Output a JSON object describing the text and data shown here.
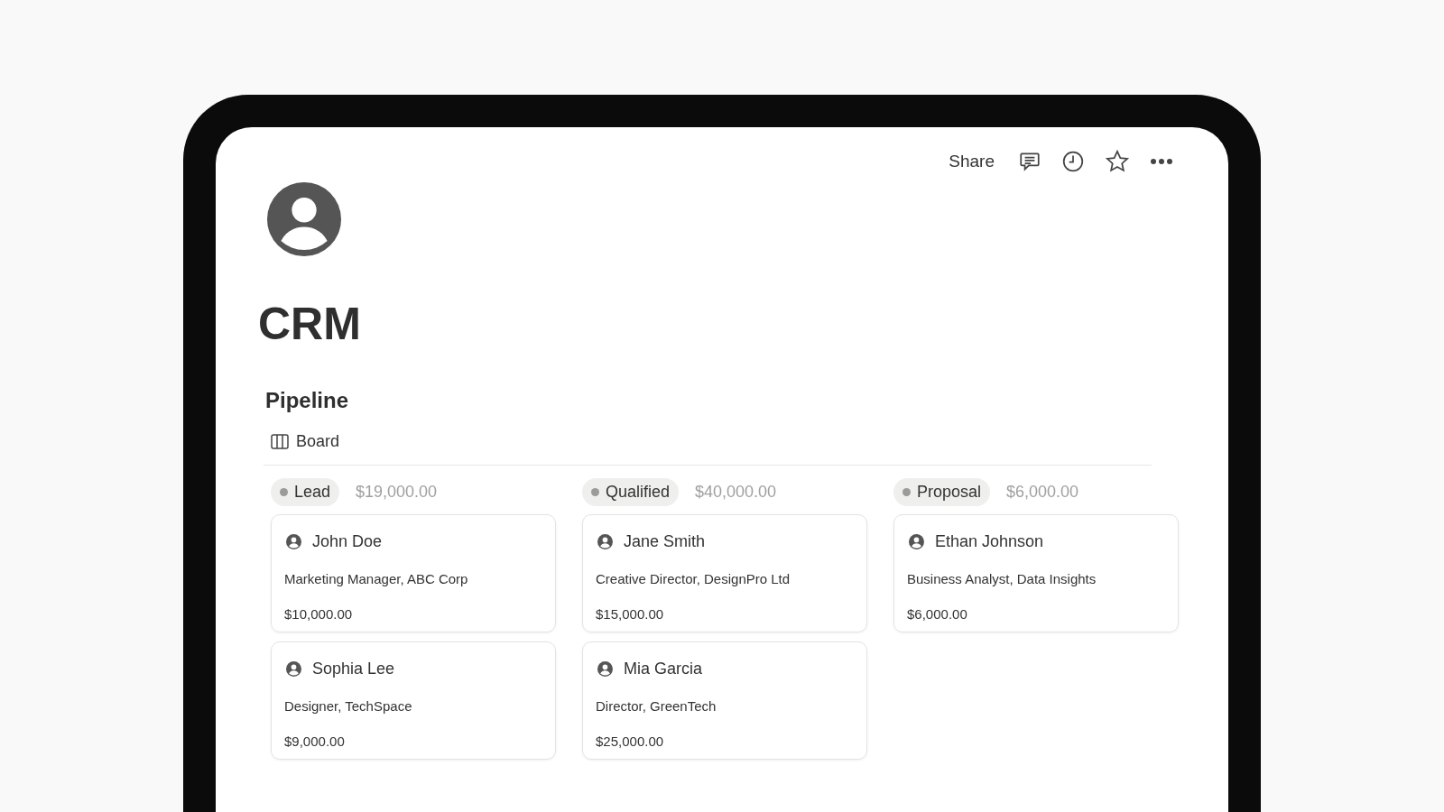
{
  "topbar": {
    "share": "Share"
  },
  "page": {
    "title": "CRM"
  },
  "section": {
    "title": "Pipeline",
    "view": "Board"
  },
  "columns": [
    {
      "label": "Lead",
      "total": "$19,000.00",
      "cards": [
        {
          "name": "John Doe",
          "role": "Marketing Manager, ABC Corp",
          "amount": "$10,000.00"
        },
        {
          "name": "Sophia Lee",
          "role": "Designer, TechSpace",
          "amount": "$9,000.00"
        }
      ]
    },
    {
      "label": "Qualified",
      "total": "$40,000.00",
      "cards": [
        {
          "name": "Jane Smith",
          "role": "Creative Director, DesignPro Ltd",
          "amount": "$15,000.00"
        },
        {
          "name": "Mia Garcia",
          "role": "Director, GreenTech",
          "amount": "$25,000.00"
        }
      ]
    },
    {
      "label": "Proposal",
      "total": "$6,000.00",
      "cards": [
        {
          "name": "Ethan Johnson",
          "role": "Business Analyst, Data Insights",
          "amount": "$6,000.00"
        }
      ]
    }
  ]
}
